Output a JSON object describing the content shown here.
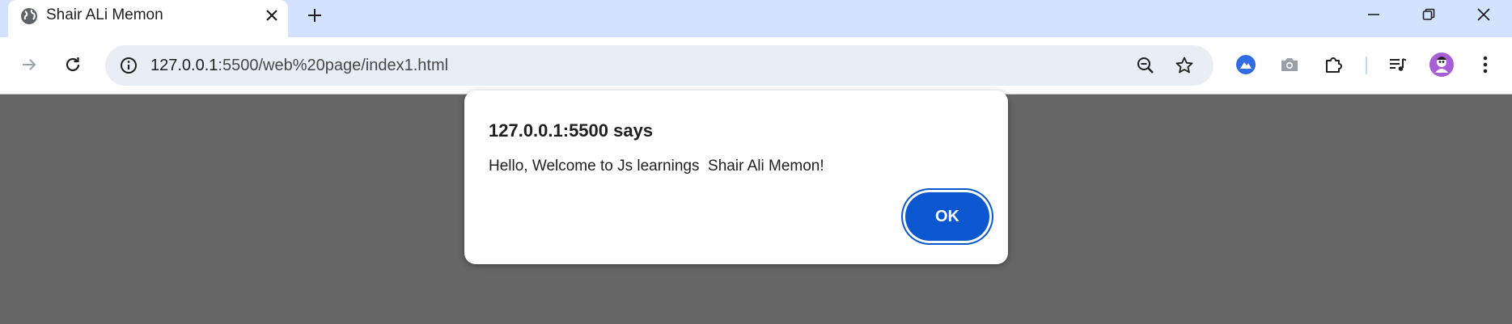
{
  "browser": {
    "tab": {
      "title": "Shair ALi Memon",
      "favicon": "globe-icon",
      "close_icon": "close-icon"
    },
    "new_tab_icon": "plus-icon",
    "window_controls": [
      "minimize-icon",
      "restore-icon",
      "close-icon"
    ],
    "nav": {
      "forward_icon": "arrow-right-icon",
      "reload_icon": "reload-icon"
    },
    "address_bar": {
      "site_info_icon": "info-icon",
      "url_host": "127.0.0.1",
      "url_path": ":5500/web%20page/index1.html",
      "zoom_icon": "zoom-out-icon",
      "bookmark_icon": "star-icon"
    },
    "extensions": [
      "blue-circle-extension-icon",
      "camera-icon",
      "puzzle-icon",
      "media-playlist-icon",
      "avatar",
      "kebab-menu-icon"
    ]
  },
  "dialog": {
    "title": "127.0.0.1:5500 says",
    "message": "Hello, Welcome to Js learnings  Shair Ali Memon!",
    "ok_label": "OK"
  },
  "colors": {
    "titlebar": "#d3e3fd",
    "page_overlay": "#666666",
    "primary_button": "#0b57d0",
    "omnibox": "#e9eef6"
  }
}
